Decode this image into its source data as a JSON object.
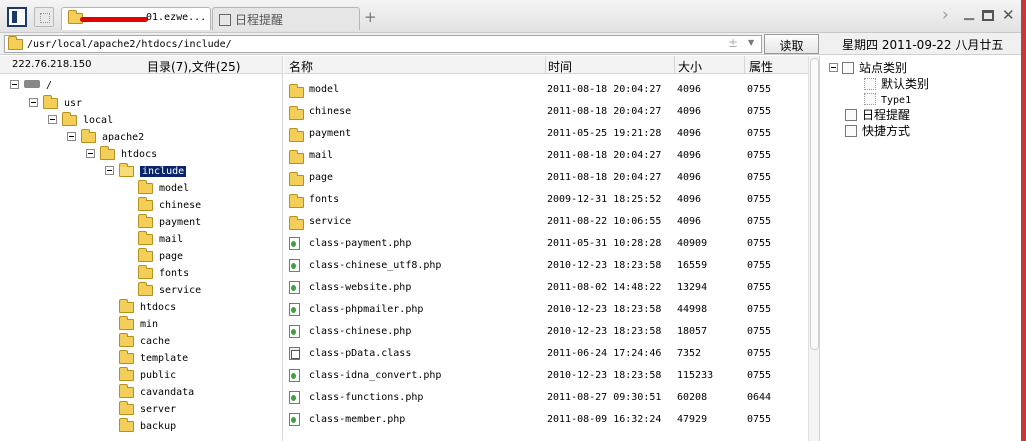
{
  "tabs": [
    {
      "label": "01.ezwe...",
      "active": true
    },
    {
      "label": "日程提醒",
      "active": false
    }
  ],
  "address": {
    "path": "/usr/local/apache2/htdocs/include/",
    "read_label": "读取"
  },
  "date_text": "星期四 2011-09-22 八月廿五",
  "left": {
    "ip": "222.76.218.150",
    "counts": "目录(7),文件(25)",
    "tree": [
      {
        "label": "/",
        "icon": "drive-icon"
      },
      {
        "label": "usr"
      },
      {
        "label": "local"
      },
      {
        "label": "apache2"
      },
      {
        "label": "htdocs"
      },
      {
        "label": "include"
      },
      {
        "label": "model"
      },
      {
        "label": "chinese"
      },
      {
        "label": "payment"
      },
      {
        "label": "mail"
      },
      {
        "label": "page"
      },
      {
        "label": "fonts"
      },
      {
        "label": "service"
      },
      {
        "label": "htdocs"
      },
      {
        "label": "min"
      },
      {
        "label": "cache"
      },
      {
        "label": "template"
      },
      {
        "label": "public"
      },
      {
        "label": "cavandata"
      },
      {
        "label": "server"
      },
      {
        "label": "backup"
      }
    ]
  },
  "files": {
    "columns": [
      "名称",
      "时间",
      "大小",
      "属性"
    ],
    "rows": [
      {
        "name": "model",
        "time": "2011-08-18 20:04:27",
        "size": "4096",
        "attr": "0755",
        "type": "folder"
      },
      {
        "name": "chinese",
        "time": "2011-08-18 20:04:27",
        "size": "4096",
        "attr": "0755",
        "type": "folder"
      },
      {
        "name": "payment",
        "time": "2011-05-25 19:21:28",
        "size": "4096",
        "attr": "0755",
        "type": "folder"
      },
      {
        "name": "mail",
        "time": "2011-08-18 20:04:27",
        "size": "4096",
        "attr": "0755",
        "type": "folder"
      },
      {
        "name": "page",
        "time": "2011-08-18 20:04:27",
        "size": "4096",
        "attr": "0755",
        "type": "folder"
      },
      {
        "name": "fonts",
        "time": "2009-12-31 18:25:52",
        "size": "4096",
        "attr": "0755",
        "type": "folder"
      },
      {
        "name": "service",
        "time": "2011-08-22 10:06:55",
        "size": "4096",
        "attr": "0755",
        "type": "folder"
      },
      {
        "name": "class-payment.php",
        "time": "2011-05-31 10:28:28",
        "size": "40909",
        "attr": "0755",
        "type": "php"
      },
      {
        "name": "class-chinese_utf8.php",
        "time": "2010-12-23 18:23:58",
        "size": "16559",
        "attr": "0755",
        "type": "php"
      },
      {
        "name": "class-website.php",
        "time": "2011-08-02 14:48:22",
        "size": "13294",
        "attr": "0755",
        "type": "php"
      },
      {
        "name": "class-phpmailer.php",
        "time": "2010-12-23 18:23:58",
        "size": "44998",
        "attr": "0755",
        "type": "php"
      },
      {
        "name": "class-chinese.php",
        "time": "2010-12-23 18:23:58",
        "size": "18057",
        "attr": "0755",
        "type": "php"
      },
      {
        "name": "class-pData.class",
        "time": "2011-06-24 17:24:46",
        "size": "7352",
        "attr": "0755",
        "type": "class"
      },
      {
        "name": "class-idna_convert.php",
        "time": "2010-12-23 18:23:58",
        "size": "115233",
        "attr": "0755",
        "type": "php"
      },
      {
        "name": "class-functions.php",
        "time": "2011-08-27 09:30:51",
        "size": "60208",
        "attr": "0644",
        "type": "php"
      },
      {
        "name": "class-member.php",
        "time": "2011-08-09 16:32:24",
        "size": "47929",
        "attr": "0755",
        "type": "php"
      }
    ]
  },
  "right": {
    "items": [
      {
        "label": "站点类别"
      },
      {
        "label": "默认类别"
      },
      {
        "label": "Type1"
      },
      {
        "label": "日程提醒"
      },
      {
        "label": "快捷方式"
      }
    ]
  }
}
